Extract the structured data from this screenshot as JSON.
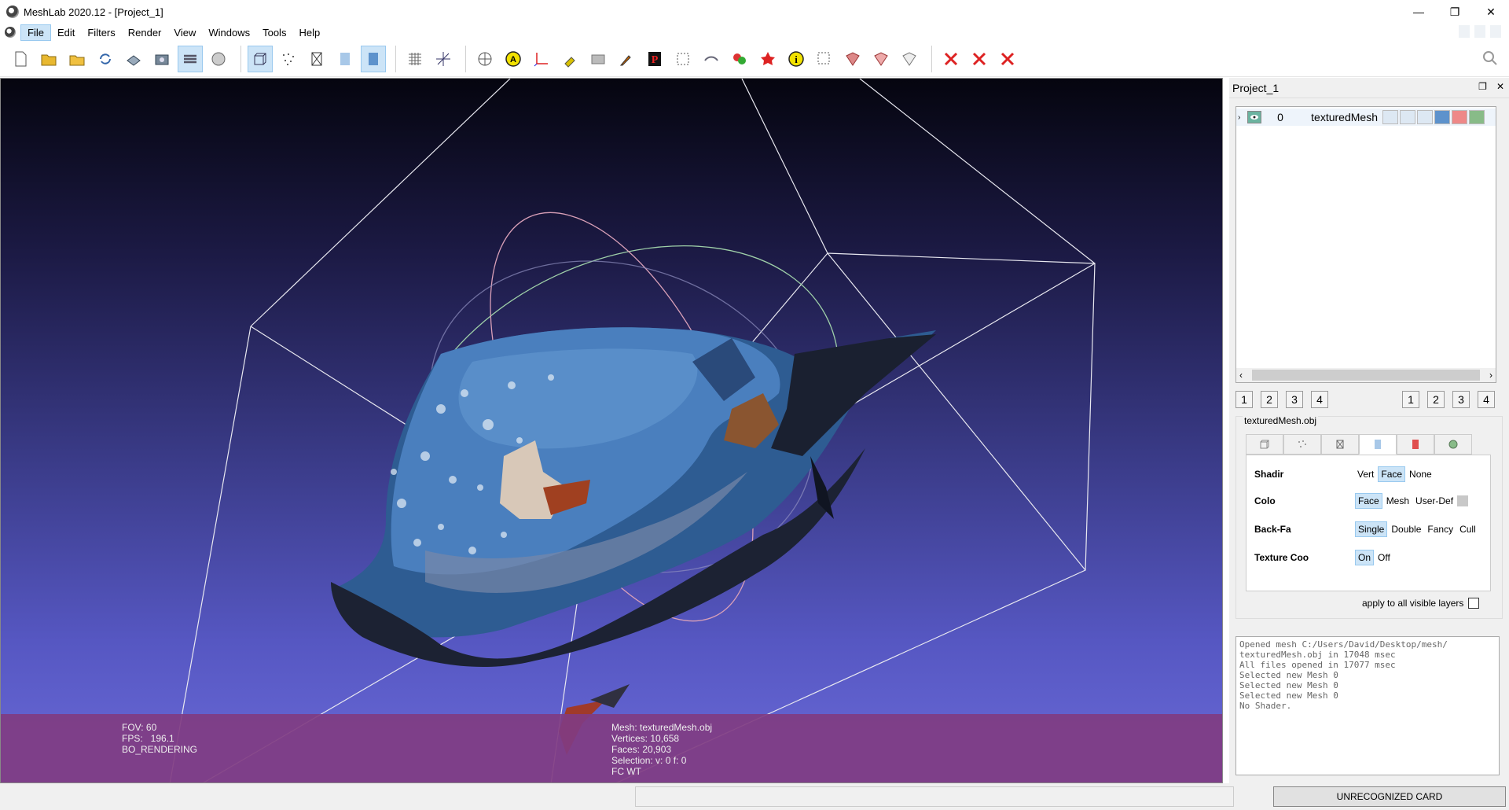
{
  "window": {
    "title": "MeshLab 2020.12 - [Project_1]"
  },
  "menu": {
    "items": [
      "File",
      "Edit",
      "Filters",
      "Render",
      "View",
      "Windows",
      "Tools",
      "Help"
    ]
  },
  "toolbar": {
    "icons": [
      "new-project-icon",
      "open-project-icon",
      "import-mesh-icon",
      "reload-icon",
      "export-mesh-icon",
      "snapshot-icon",
      "layer-stack-icon",
      "sphere-icon",
      "bounding-box-icon",
      "points-icon",
      "wireframe-icon",
      "flat-shading-icon",
      "smooth-shading-icon",
      "grid-icon",
      "axis-icon",
      "trackball-icon",
      "annotation-icon",
      "axes-icon",
      "pick-icon",
      "camera-icon",
      "paint-icon",
      "p-icon",
      "select-icon",
      "align-icon",
      "color-icon",
      "georef-icon",
      "info-icon",
      "select-rect-icon",
      "select-faces-icon",
      "select-vertices-icon",
      "select-conn-icon",
      "delete-faces-icon",
      "delete-vertices-icon",
      "delete-all-icon"
    ]
  },
  "viewport": {
    "info_left": [
      "FOV: 60",
      "FPS:   196.1",
      "BO_RENDERING"
    ],
    "info_mid": [
      "Mesh: texturedMesh.obj",
      "Vertices: 10,658",
      "Faces: 20,903",
      "Selection: v: 0 f: 0",
      "FC WT"
    ]
  },
  "panel": {
    "title": "Project_1",
    "layer": {
      "index": "0",
      "name": "texturedMesh"
    },
    "num_buttons_left": [
      "1",
      "2",
      "3",
      "4"
    ],
    "num_buttons_right": [
      "1",
      "2",
      "3",
      "4"
    ],
    "mesh_title": "texturedMesh.obj",
    "props": [
      {
        "label": "Shading",
        "options": [
          "Vert",
          "Face",
          "None"
        ],
        "selected": "Face"
      },
      {
        "label": "Color",
        "options": [
          "Face",
          "Mesh",
          "User-Def"
        ],
        "selected": "Face"
      },
      {
        "label": "Back-Face",
        "options": [
          "Single",
          "Double",
          "Fancy",
          "Cull"
        ],
        "selected": "Single"
      },
      {
        "label": "Texture Coord",
        "options": [
          "On",
          "Off"
        ],
        "selected": "On"
      }
    ],
    "apply_label": "apply to all visible layers",
    "log": "Opened mesh C:/Users/David/Desktop/mesh/\ntexturedMesh.obj in 17048 msec\nAll files opened in 17077 msec\nSelected new Mesh 0\nSelected new Mesh 0\nSelected new Mesh 0\nNo Shader."
  },
  "status": {
    "card": "UNRECOGNIZED CARD"
  }
}
